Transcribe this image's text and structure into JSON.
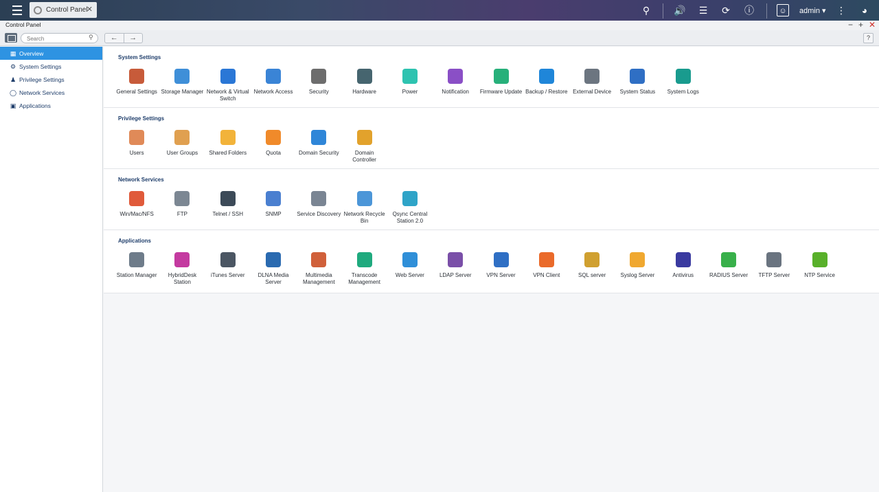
{
  "tab": {
    "label": "Control Panel"
  },
  "user": {
    "name": "admin ▾"
  },
  "window": {
    "title": "Control Panel"
  },
  "search": {
    "placeholder": "Search"
  },
  "sidebar": {
    "items": [
      {
        "label": "Overview",
        "icon": "grid-icon"
      },
      {
        "label": "System Settings",
        "icon": "gear-icon"
      },
      {
        "label": "Privilege Settings",
        "icon": "person-icon"
      },
      {
        "label": "Network Services",
        "icon": "network-icon"
      },
      {
        "label": "Applications",
        "icon": "apps-icon"
      }
    ]
  },
  "sections": [
    {
      "title": "System Settings",
      "apps": [
        {
          "label": "General Settings",
          "color": "#c75b3a"
        },
        {
          "label": "Storage Manager",
          "color": "#3f8fd8"
        },
        {
          "label": "Network & Virtual Switch",
          "color": "#2a77d6"
        },
        {
          "label": "Network Access",
          "color": "#3a84d6"
        },
        {
          "label": "Security",
          "color": "#6d6d6d"
        },
        {
          "label": "Hardware",
          "color": "#46656f"
        },
        {
          "label": "Power",
          "color": "#2ec3b0"
        },
        {
          "label": "Notification",
          "color": "#8a4fc6"
        },
        {
          "label": "Firmware Update",
          "color": "#27b07a"
        },
        {
          "label": "Backup / Restore",
          "color": "#1f86d9"
        },
        {
          "label": "External Device",
          "color": "#6c7580"
        },
        {
          "label": "System Status",
          "color": "#2f6fc4"
        },
        {
          "label": "System Logs",
          "color": "#199b8e"
        }
      ]
    },
    {
      "title": "Privilege Settings",
      "apps": [
        {
          "label": "Users",
          "color": "#e08a58"
        },
        {
          "label": "User Groups",
          "color": "#e0a050"
        },
        {
          "label": "Shared Folders",
          "color": "#f2b33a"
        },
        {
          "label": "Quota",
          "color": "#f08a2a"
        },
        {
          "label": "Domain Security",
          "color": "#2f86d8"
        },
        {
          "label": "Domain Controller",
          "color": "#e2a22c"
        }
      ]
    },
    {
      "title": "Network Services",
      "apps": [
        {
          "label": "Win/Mac/NFS",
          "color": "#e05a3a"
        },
        {
          "label": "FTP",
          "color": "#7c8793"
        },
        {
          "label": "Telnet / SSH",
          "color": "#3c4a58"
        },
        {
          "label": "SNMP",
          "color": "#4a7fd0"
        },
        {
          "label": "Service Discovery",
          "color": "#7a8593"
        },
        {
          "label": "Network Recycle Bin",
          "color": "#4c96d8"
        },
        {
          "label": "Qsync Central Station 2.0",
          "color": "#2fa4c8"
        }
      ]
    },
    {
      "title": "Applications",
      "apps": [
        {
          "label": "Station Manager",
          "color": "#6e7c8a"
        },
        {
          "label": "HybridDesk Station",
          "color": "#c43aa0"
        },
        {
          "label": "iTunes Server",
          "color": "#4b5663"
        },
        {
          "label": "DLNA Media Server",
          "color": "#2a6ab0"
        },
        {
          "label": "Multimedia Management",
          "color": "#d0603a"
        },
        {
          "label": "Transcode Management",
          "color": "#1faa7e"
        },
        {
          "label": "Web Server",
          "color": "#2f8fd8"
        },
        {
          "label": "LDAP Server",
          "color": "#7a4fa8"
        },
        {
          "label": "VPN Server",
          "color": "#2f6fc4"
        },
        {
          "label": "VPN Client",
          "color": "#ea6a2a"
        },
        {
          "label": "SQL server",
          "color": "#d0a030"
        },
        {
          "label": "Syslog Server",
          "color": "#f0a830"
        },
        {
          "label": "Antivirus",
          "color": "#3a3aa0"
        },
        {
          "label": "RADIUS Server",
          "color": "#38b04a"
        },
        {
          "label": "TFTP Server",
          "color": "#6a7480"
        },
        {
          "label": "NTP Service",
          "color": "#58b02a"
        }
      ]
    }
  ]
}
